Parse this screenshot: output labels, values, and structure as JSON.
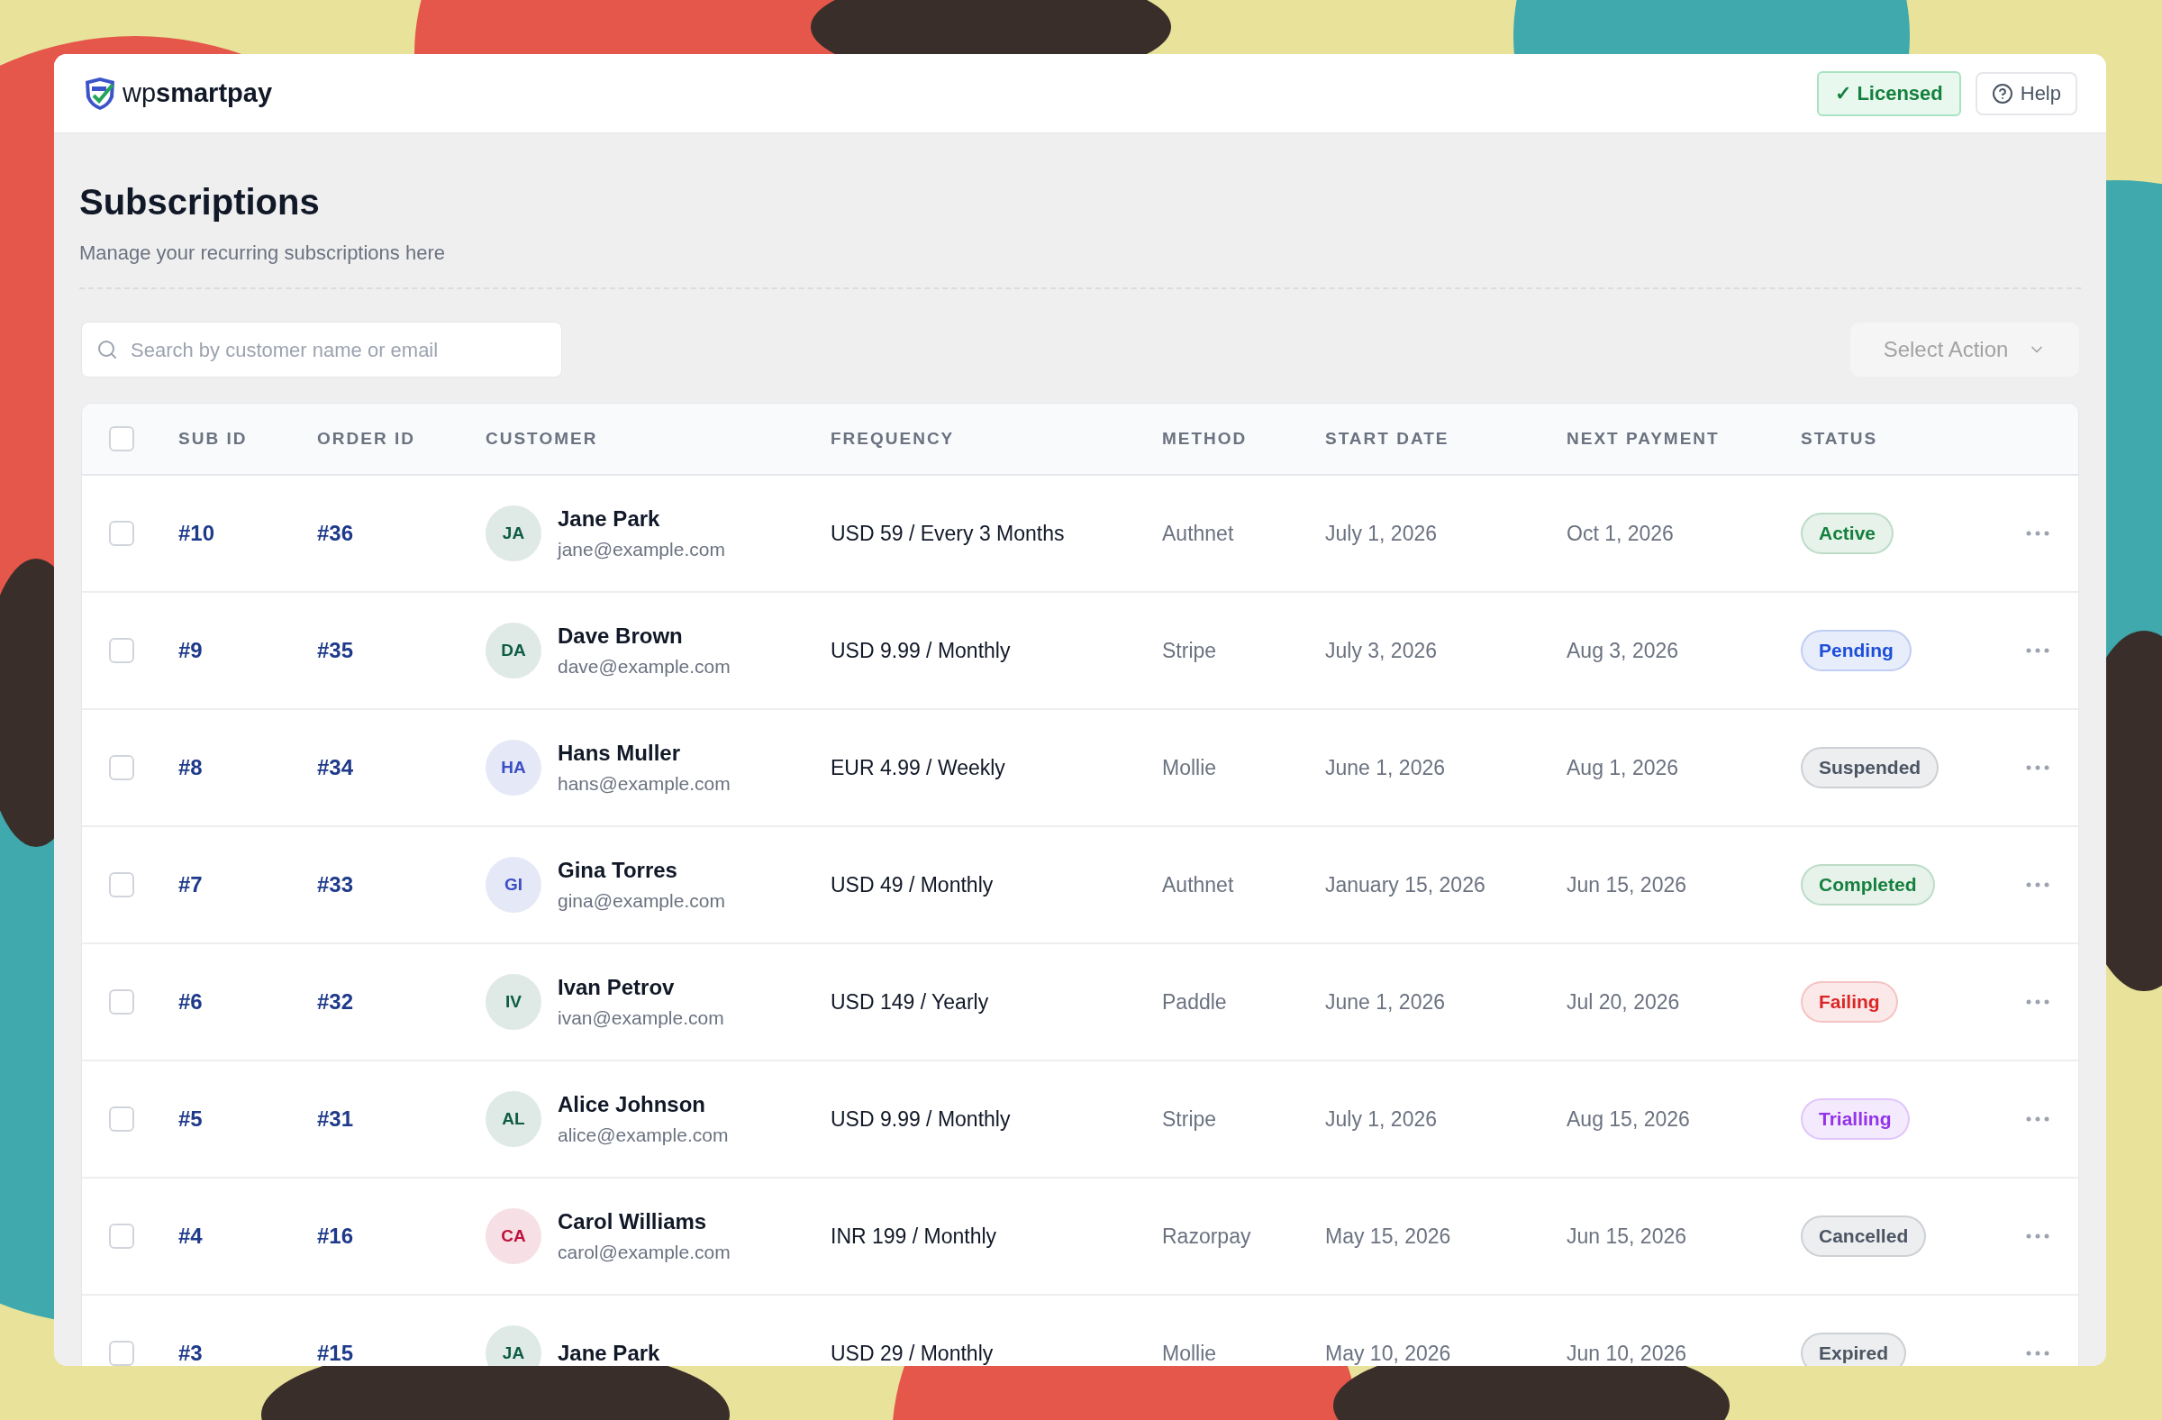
{
  "header": {
    "brand": {
      "prefix": "wp",
      "name": "smartpay"
    },
    "licensed": "✓ Licensed",
    "help": "Help"
  },
  "page": {
    "title": "Subscriptions",
    "subtitle": "Manage your recurring subscriptions here"
  },
  "search": {
    "placeholder": "Search by customer name or email"
  },
  "action_select": {
    "placeholder": "Select Action"
  },
  "table": {
    "select_all": {
      "checked": false
    },
    "columns": [
      "SUB ID",
      "ORDER ID",
      "CUSTOMER",
      "FREQUENCY",
      "METHOD",
      "START DATE",
      "NEXT PAYMENT",
      "STATUS"
    ],
    "rows": [
      {
        "checked": false,
        "sub_id": "#10",
        "order_id": "#36",
        "avatar": {
          "initials": "JA",
          "color": "#0f5c45"
        },
        "name": "Jane Park",
        "email": "jane@example.com",
        "frequency": "USD 59 / Every 3 Months",
        "method": "Authnet",
        "start": "July 1, 2026",
        "next": "Oct 1, 2026",
        "status": {
          "label": "Active",
          "color": "#15803d"
        }
      },
      {
        "checked": false,
        "sub_id": "#9",
        "order_id": "#35",
        "avatar": {
          "initials": "DA",
          "color": "#0f5c45"
        },
        "name": "Dave Brown",
        "email": "dave@example.com",
        "frequency": "USD 9.99 / Monthly",
        "method": "Stripe",
        "start": "July 3, 2026",
        "next": "Aug 3, 2026",
        "status": {
          "label": "Pending",
          "color": "#1d4ed8"
        }
      },
      {
        "checked": false,
        "sub_id": "#8",
        "order_id": "#34",
        "avatar": {
          "initials": "HA",
          "color": "#3b4fc4"
        },
        "name": "Hans Muller",
        "email": "hans@example.com",
        "frequency": "EUR 4.99 / Weekly",
        "method": "Mollie",
        "start": "June 1, 2026",
        "next": "Aug 1, 2026",
        "status": {
          "label": "Suspended",
          "color": "#4b5563"
        }
      },
      {
        "checked": false,
        "sub_id": "#7",
        "order_id": "#33",
        "avatar": {
          "initials": "GI",
          "color": "#3b4fc4"
        },
        "name": "Gina Torres",
        "email": "gina@example.com",
        "frequency": "USD 49 / Monthly",
        "method": "Authnet",
        "start": "January 15, 2026",
        "next": "Jun 15, 2026",
        "status": {
          "label": "Completed",
          "color": "#15803d"
        }
      },
      {
        "checked": false,
        "sub_id": "#6",
        "order_id": "#32",
        "avatar": {
          "initials": "IV",
          "color": "#0f5c45"
        },
        "name": "Ivan Petrov",
        "email": "ivan@example.com",
        "frequency": "USD 149 / Yearly",
        "method": "Paddle",
        "start": "June 1, 2026",
        "next": "Jul 20, 2026",
        "status": {
          "label": "Failing",
          "color": "#dc2626"
        }
      },
      {
        "checked": false,
        "sub_id": "#5",
        "order_id": "#31",
        "avatar": {
          "initials": "AL",
          "color": "#0f5c45"
        },
        "name": "Alice Johnson",
        "email": "alice@example.com",
        "frequency": "USD 9.99 / Monthly",
        "method": "Stripe",
        "start": "July 1, 2026",
        "next": "Aug 15, 2026",
        "status": {
          "label": "Trialling",
          "color": "#9333ea"
        }
      },
      {
        "checked": false,
        "sub_id": "#4",
        "order_id": "#16",
        "avatar": {
          "initials": "CA",
          "color": "#be123c"
        },
        "name": "Carol Williams",
        "email": "carol@example.com",
        "frequency": "INR 199 / Monthly",
        "method": "Razorpay",
        "start": "May 15, 2026",
        "next": "Jun 15, 2026",
        "status": {
          "label": "Cancelled",
          "color": "#4b5563"
        }
      },
      {
        "checked": false,
        "sub_id": "#3",
        "order_id": "#15",
        "avatar": {
          "initials": "JA",
          "color": "#0f5c45"
        },
        "name": "Jane Park",
        "frequency": "USD 29 / Monthly",
        "method": "Mollie",
        "start": "May 10, 2026",
        "next": "Jun 10, 2026",
        "status": {
          "label": "Expired",
          "color": "#4b5563"
        }
      }
    ]
  }
}
